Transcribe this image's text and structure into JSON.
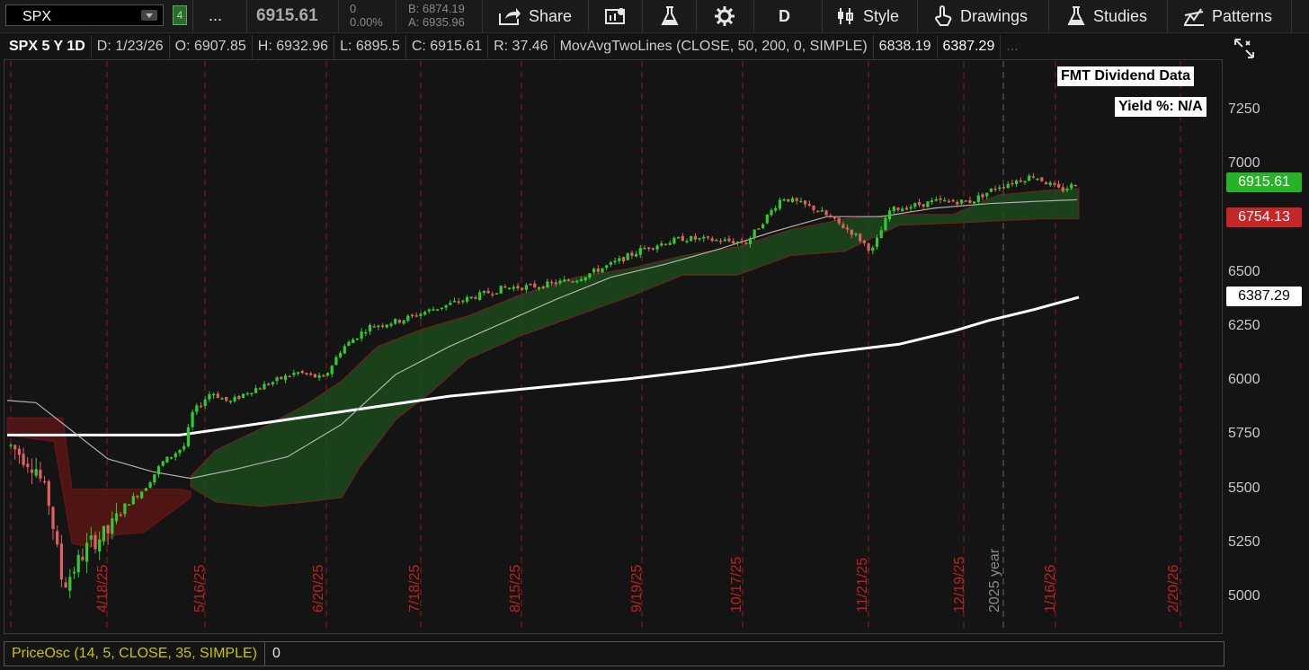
{
  "toolbar": {
    "symbol": "SPX",
    "link_badge": "4",
    "more": "...",
    "last_price": "6915.61",
    "net_change": "0",
    "pct_change": "0.00%",
    "bid": "B: 6874.19",
    "ask": "A: 6935.96",
    "share_label": "Share",
    "period_label": "D",
    "style_label": "Style",
    "drawings_label": "Drawings",
    "studies_label": "Studies",
    "patterns_label": "Patterns"
  },
  "header": {
    "symbol_period": "SPX 5 Y 1D",
    "date": "D: 1/23/26",
    "open": "O: 6907.85",
    "high": "H: 6932.96",
    "low": "L: 6895.5",
    "close": "C: 6915.61",
    "range": "R: 37.46",
    "study": "MovAvgTwoLines (CLOSE, 50, 200, 0, SIMPLE)",
    "ma_fast": "6838.19",
    "ma_slow": "6387.29",
    "dots": "..."
  },
  "overlays": {
    "dividend_title": "FMT Dividend Data",
    "yield": "Yield %: N/A"
  },
  "price_tags": {
    "last": "6915.61",
    "cloud": "6754.13",
    "ma200": "6387.29"
  },
  "y_axis": [
    "7250",
    "7000",
    "6750",
    "6500",
    "6250",
    "6000",
    "5750",
    "5500",
    "5250",
    "5000"
  ],
  "x_axis": [
    "4/18/25",
    "5/16/25",
    "6/20/25",
    "7/18/25",
    "8/15/25",
    "9/19/25",
    "10/17/25",
    "11/21/25",
    "12/19/25",
    "2025 year",
    "1/16/26",
    "2/20/26"
  ],
  "oscillator": {
    "name": "PriceOsc (14, 5, CLOSE, 35, SIMPLE)",
    "value": "0"
  },
  "colors": {
    "up": "#2ecc2e",
    "down": "#e06060",
    "cloud_green": "#1d4a1d",
    "cloud_red": "#5a1414",
    "ma_slow": "#ffffff",
    "ma_fast": "#b0b0b0",
    "grid_red": "#8a1a1a"
  },
  "chart_data": {
    "type": "candlestick",
    "x_axis_labels": [
      "4/18/25",
      "5/16/25",
      "6/20/25",
      "7/18/25",
      "8/15/25",
      "9/19/25",
      "10/17/25",
      "11/21/25",
      "12/19/25",
      "1/16/26",
      "2/20/26"
    ],
    "ylim": [
      4900,
      7350
    ],
    "y_ticks": [
      5000,
      5250,
      5500,
      5750,
      6000,
      6250,
      6500,
      6750,
      7000,
      7250
    ],
    "close_trend": [
      [
        "4/18/25",
        5280
      ],
      [
        "5/16/25",
        5950
      ],
      [
        "6/20/25",
        6000
      ],
      [
        "7/18/25",
        6300
      ],
      [
        "8/15/25",
        6450
      ],
      [
        "9/19/25",
        6650
      ],
      [
        "10/17/25",
        6680
      ],
      [
        "11/21/25",
        6600
      ],
      [
        "12/19/25",
        6840
      ],
      [
        "1/16/26",
        6940
      ]
    ],
    "series": [
      {
        "name": "MovAvg 200",
        "last": 6387.29
      },
      {
        "name": "MovAvg 50",
        "last": 6838.19
      }
    ],
    "last_close": 6915.61
  }
}
